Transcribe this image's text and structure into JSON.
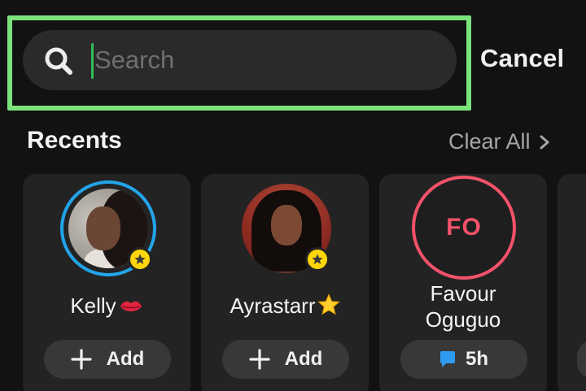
{
  "search": {
    "placeholder": "Search",
    "value": "",
    "icon": "search-icon"
  },
  "header": {
    "cancel_label": "Cancel"
  },
  "recents": {
    "title": "Recents",
    "clear_all_label": "Clear All",
    "items": [
      {
        "name": "Kelly",
        "emoji": "lips",
        "badge": "star",
        "ring_color": "#23a4ea",
        "action_label": "Add",
        "action_icon": "plus-icon"
      },
      {
        "name": "Ayrastarr",
        "emoji": "star",
        "badge": "star",
        "action_label": "Add",
        "action_icon": "plus-icon"
      },
      {
        "name_line1": "Favour",
        "name_line2": "Oguguo",
        "initials": "FO",
        "ring_color": "#f2526a",
        "action_label": "5h",
        "action_icon": "chat-icon"
      }
    ]
  },
  "colors": {
    "highlight": "#7be37b",
    "accent_blue": "#23a4ea",
    "accent_red": "#f2526a",
    "badge_yellow": "#ffd60a",
    "caret": "#2fbf55"
  }
}
